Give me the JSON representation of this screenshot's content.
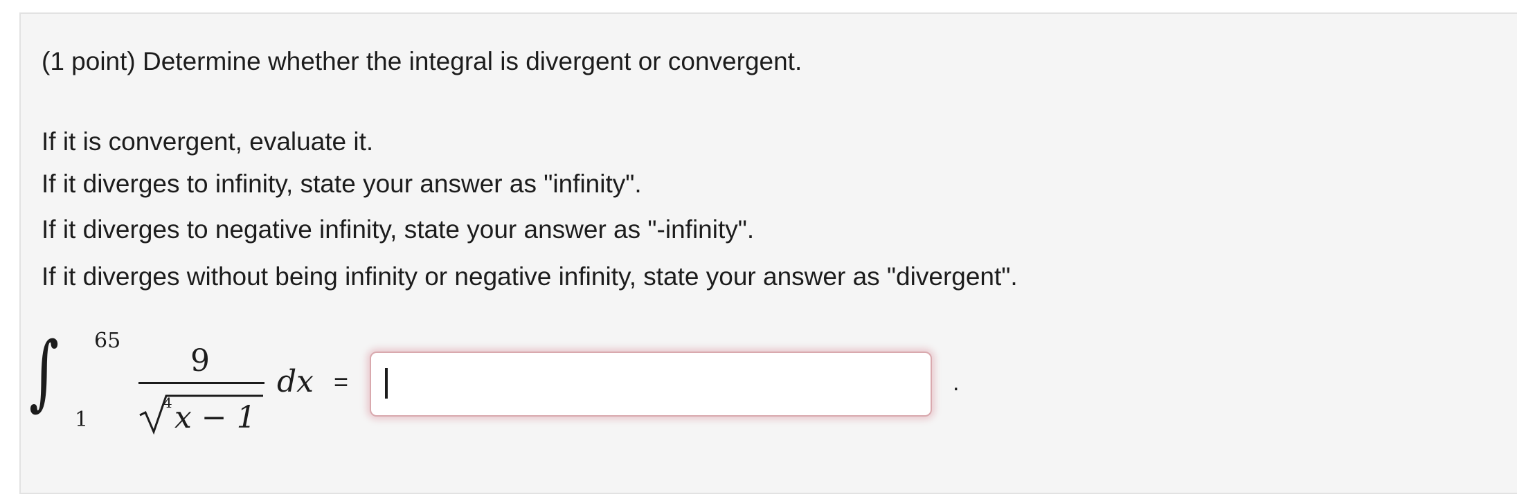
{
  "problem": {
    "headline": "(1 point) Determine whether the integral is divergent or convergent.",
    "instructions": [
      "If it is convergent, evaluate it.",
      "If it diverges to infinity, state your answer as \"infinity\".",
      "If it diverges to negative infinity, state your answer as \"-infinity\".",
      "If it diverges without being infinity or negative infinity, state your answer as \"divergent\"."
    ]
  },
  "integral": {
    "sign": "∫",
    "upper_limit": "65",
    "lower_limit": "1",
    "numerator": "9",
    "radical_index": "4",
    "radicand": "x − 1",
    "differential": "dx",
    "equals": "="
  },
  "answer": {
    "value": "",
    "placeholder": ""
  },
  "trailing_period": ".",
  "colors": {
    "panel_background": "#f5f5f5",
    "input_focus_border": "#d9a9ae",
    "text": "#1c1c1c"
  }
}
